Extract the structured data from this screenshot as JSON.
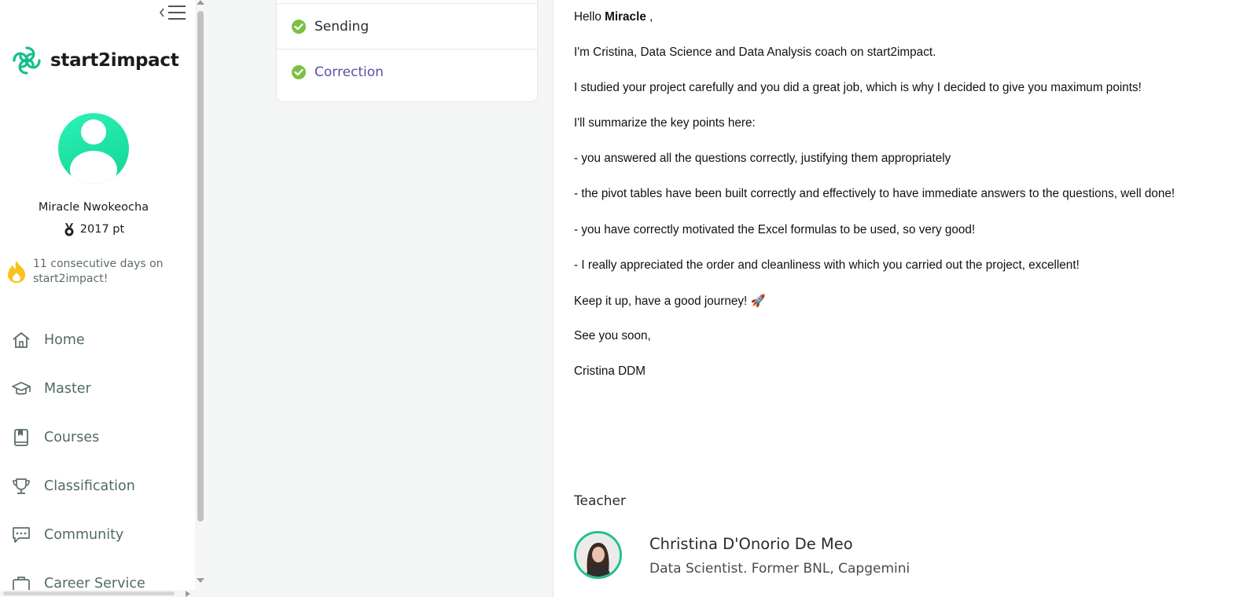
{
  "brand": {
    "name": "start2impact"
  },
  "user": {
    "name": "Miracle Nwokeocha",
    "points": "2017 pt",
    "streak": "11 consecutive days on start2impact!"
  },
  "nav": {
    "items": [
      {
        "label": "Home",
        "icon": "home-icon"
      },
      {
        "label": "Master",
        "icon": "graduation-cap-icon"
      },
      {
        "label": "Courses",
        "icon": "book-icon"
      },
      {
        "label": "Classification",
        "icon": "trophy-icon"
      },
      {
        "label": "Community",
        "icon": "chat-icon"
      },
      {
        "label": "Career Service",
        "icon": "briefcase-icon"
      }
    ]
  },
  "steps": [
    {
      "label": "Sending",
      "status": "completed"
    },
    {
      "label": "Correction",
      "status": "completed",
      "active": true
    }
  ],
  "message": {
    "greeting_prefix": "Hello",
    "greeting_name": "Miracle",
    "greeting_suffix": ",",
    "lines": [
      "I'm Cristina, Data Science and Data Analysis coach on start2impact.",
      "I studied your project carefully and you did a great job, which is why I decided to give you maximum points!",
      "I'll summarize the key points here:",
      "- you answered all the questions correctly, justifying them appropriately",
      "- the pivot tables have been built correctly and effectively to have immediate answers to the questions, well done!",
      "- you have correctly motivated the Excel formulas to be used, so very good!",
      "- I really appreciated the order and cleanliness with which you carried out the project, excellent!",
      "Keep it up, have a good journey! 🚀",
      "See you soon,",
      "Cristina DDM"
    ]
  },
  "teacher": {
    "heading": "Teacher",
    "name": "Christina D'Onorio De Meo",
    "role": "Data Scientist. Former BNL, Capgemini"
  },
  "colors": {
    "accent_green": "#10d592",
    "check_green": "#7bc043",
    "active_step": "#5a4fa6",
    "nav_text": "#4f6b65",
    "streak_flame": "#f7c21b"
  }
}
